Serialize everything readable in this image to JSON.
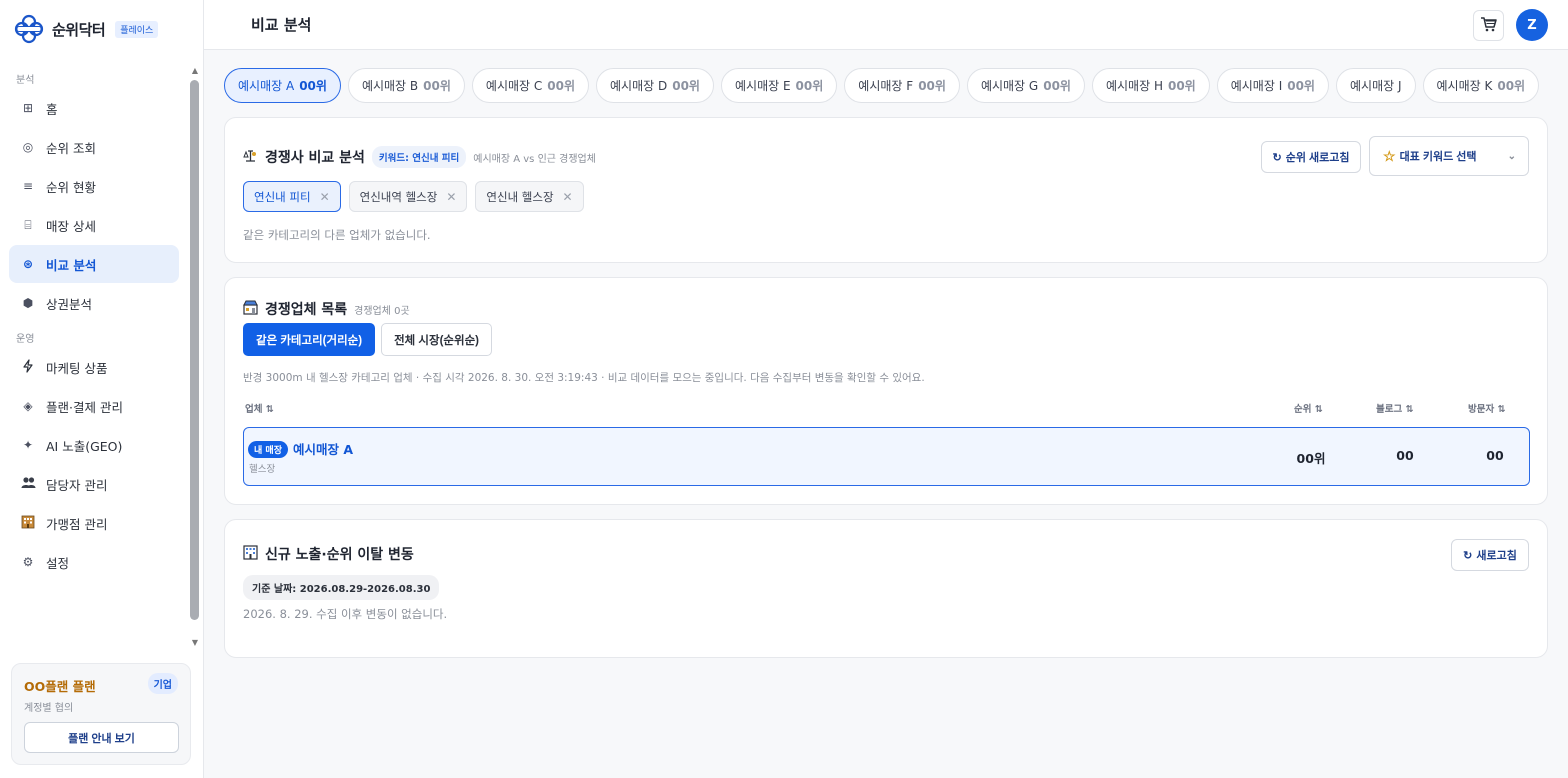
{
  "brand": {
    "name": "순위닥터",
    "badge": "플레이스"
  },
  "sidebar": {
    "sections": [
      {
        "label": "분석"
      },
      {
        "label": "운영"
      }
    ],
    "items": [
      {
        "label": "홈",
        "icon": "grid-icon"
      },
      {
        "label": "순위 조회",
        "icon": "target-icon"
      },
      {
        "label": "순위 현황",
        "icon": "list-icon"
      },
      {
        "label": "매장 상세",
        "icon": "store-icon"
      },
      {
        "label": "비교 분석",
        "icon": "compare-icon",
        "active": true
      },
      {
        "label": "상권분석",
        "icon": "hexagon-icon"
      },
      {
        "label": "마케팅 상품",
        "icon": "lightning-icon"
      },
      {
        "label": "플랜·결제 관리",
        "icon": "diamond-icon"
      },
      {
        "label": "AI 노출(GEO)",
        "icon": "sparkle-icon"
      },
      {
        "label": "담당자 관리",
        "icon": "people-icon"
      },
      {
        "label": "가맹점 관리",
        "icon": "building-icon"
      },
      {
        "label": "설정",
        "icon": "gear-icon"
      }
    ],
    "plan": {
      "title": "OO플랜 플랜",
      "badge": "기업",
      "sub": "계정별 협의",
      "button": "플랜 안내 보기"
    }
  },
  "header": {
    "title": "비교 분석",
    "avatar": "Z"
  },
  "stores": [
    {
      "name": "예시매장 A",
      "rank": "00위",
      "active": true
    },
    {
      "name": "예시매장 B",
      "rank": "00위"
    },
    {
      "name": "예시매장 C",
      "rank": "00위"
    },
    {
      "name": "예시매장 D",
      "rank": "00위"
    },
    {
      "name": "예시매장 E",
      "rank": "00위"
    },
    {
      "name": "예시매장 F",
      "rank": "00위"
    },
    {
      "name": "예시매장 G",
      "rank": "00위"
    },
    {
      "name": "예시매장 H",
      "rank": "00위"
    },
    {
      "name": "예시매장 I",
      "rank": "00위"
    },
    {
      "name": "예시매장 J",
      "rank": ""
    },
    {
      "name": "예시매장 K",
      "rank": "00위"
    }
  ],
  "competitor_analysis": {
    "title": "경쟁사 비교 분석",
    "keyword_badge": "키워드: 연신내 피티",
    "subtitle": "예시매장 A vs 인근 경쟁업체",
    "refresh_button": "순위 새로고침",
    "keyword_select": "대표 키워드 선택",
    "keywords": [
      "연신내 피티",
      "연신내역 헬스장",
      "연신내 헬스장"
    ],
    "empty": "같은 카테고리의 다른 업체가 없습니다."
  },
  "competitor_list": {
    "title": "경쟁업체 목록",
    "count": "경쟁업체 0곳",
    "tabs": [
      "같은 카테고리(거리순)",
      "전체 시장(순위순)"
    ],
    "info": "반경 3000m 내 헬스장 카테고리 업체 · 수집 시각 2026. 8. 30. 오전 3:19:43 · 비교 데이터를 모으는 중입니다. 다음 수집부터 변동을 확인할 수 있어요.",
    "columns": {
      "name": "업체 ⇅",
      "rank": "순위 ⇅",
      "blog": "블로그 ⇅",
      "visitor": "방문자 ⇅"
    },
    "row": {
      "badge": "내 매장",
      "name": "예시매장 A",
      "category": "헬스장",
      "rank": "00위",
      "blog": "00",
      "visitor": "00"
    }
  },
  "changes": {
    "title": "신규 노출·순위 이탈 변동",
    "refresh": "새로고침",
    "date": "기준 날짜: 2026.08.29-2026.08.30",
    "empty": "2026. 8. 29. 수집 이후 변동이 없습니다."
  },
  "colors": {
    "accent": "#1160e6",
    "active_bg": "#e7effc",
    "plan_title": "#b46b06"
  }
}
